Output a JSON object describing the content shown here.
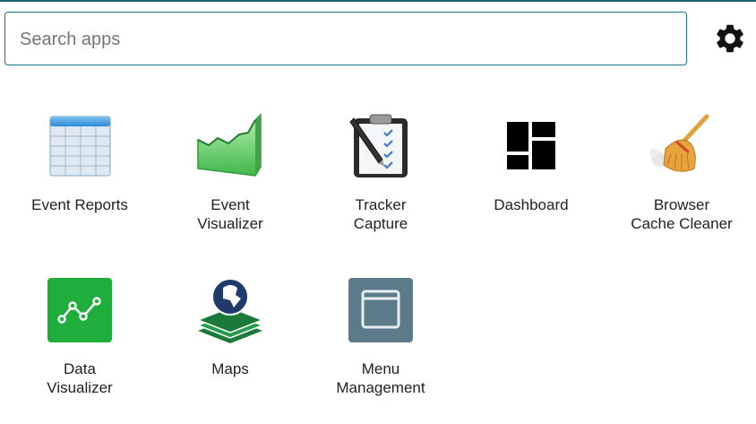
{
  "search": {
    "placeholder": "Search apps",
    "value": ""
  },
  "settings": {
    "icon": "gear-icon"
  },
  "apps": [
    {
      "label": "Event Reports",
      "icon": "table-icon"
    },
    {
      "label": "Event\nVisualizer",
      "icon": "area-chart-icon"
    },
    {
      "label": "Tracker\nCapture",
      "icon": "clipboard-pen-icon"
    },
    {
      "label": "Dashboard",
      "icon": "dashboard-grid-icon"
    },
    {
      "label": "Browser\nCache Cleaner",
      "icon": "broom-icon"
    },
    {
      "label": "Data\nVisualizer",
      "icon": "line-chart-icon"
    },
    {
      "label": "Maps",
      "icon": "globe-layers-icon"
    },
    {
      "label": "Menu\nManagement",
      "icon": "window-icon"
    }
  ],
  "colors": {
    "accent": "#147a8a",
    "data_visualizer": "#1fae3b",
    "menu_management": "#5b7a8a",
    "maps_green": "#1b7a3a",
    "maps_blue": "#1f3b6b"
  }
}
